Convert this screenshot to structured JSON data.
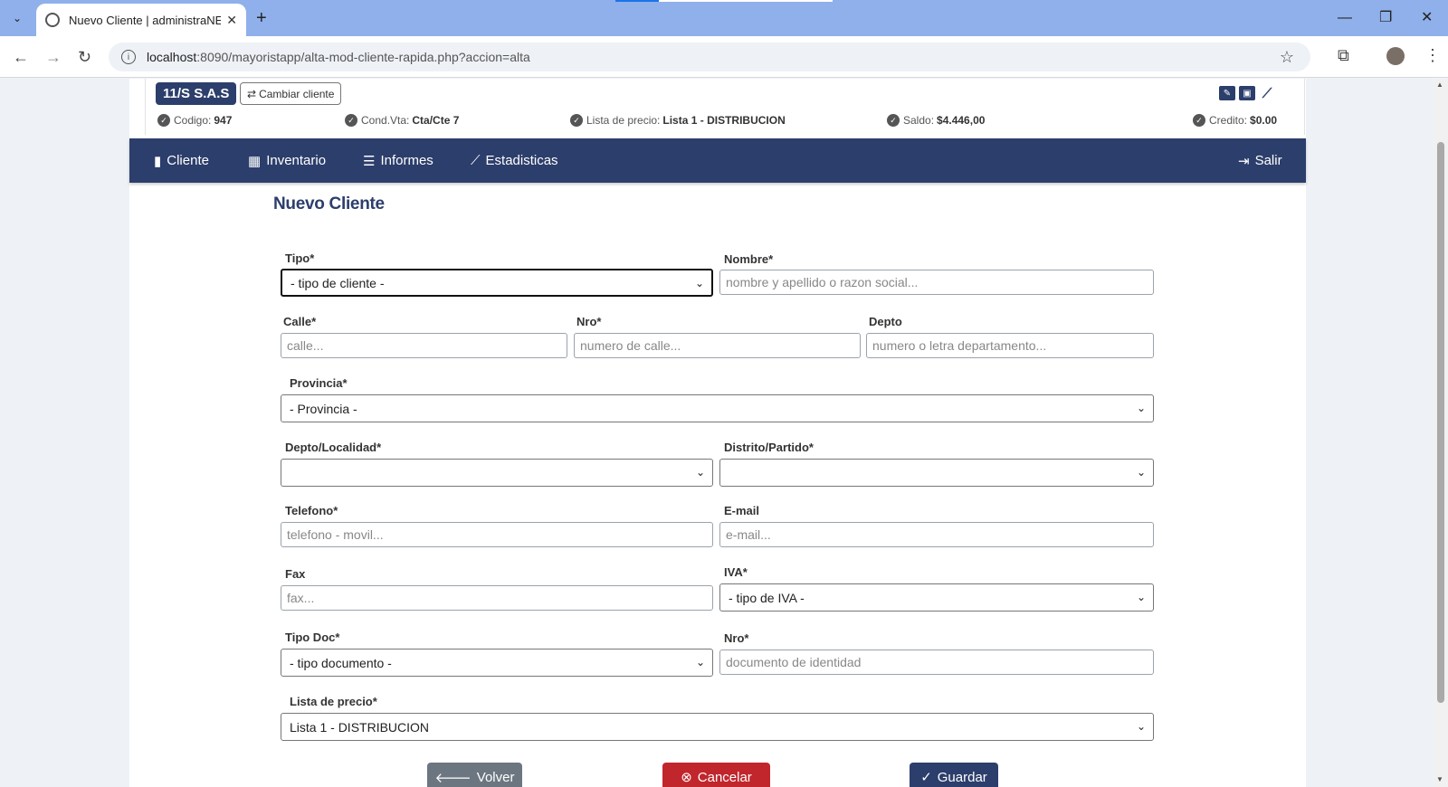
{
  "browser": {
    "tab_title": "Nuevo Cliente | administraNET",
    "url_host": "localhost",
    "url_path": ":8090/mayoristapp/alta-mod-cliente-rapida.php?accion=alta"
  },
  "client": {
    "name": "11/S S.A.S",
    "change_label": "Cambiar cliente",
    "stats": [
      {
        "label": "Codigo:",
        "value": "947"
      },
      {
        "label": "Cond.Vta:",
        "value": "Cta/Cte 7"
      },
      {
        "label": "Lista de precio:",
        "value": "Lista 1 - DISTRIBUCION"
      },
      {
        "label": "Saldo:",
        "value": "$4.446,00"
      },
      {
        "label": "Credito:",
        "value": "$0.00"
      }
    ]
  },
  "nav": {
    "cliente": "Cliente",
    "inventario": "Inventario",
    "informes": "Informes",
    "estadisticas": "Estadisticas",
    "salir": "Salir"
  },
  "form": {
    "title": "Nuevo Cliente",
    "tipo": {
      "label": "Tipo*",
      "value": "- tipo de cliente -"
    },
    "nombre": {
      "label": "Nombre*",
      "placeholder": "nombre y apellido o razon social..."
    },
    "calle": {
      "label": "Calle*",
      "placeholder": "calle..."
    },
    "nro": {
      "label": "Nro*",
      "placeholder": "numero de calle..."
    },
    "depto": {
      "label": "Depto",
      "placeholder": "numero o letra departamento..."
    },
    "provincia": {
      "label": "Provincia*",
      "value": "- Provincia -"
    },
    "localidad": {
      "label": "Depto/Localidad*",
      "value": ""
    },
    "distrito": {
      "label": "Distrito/Partido*",
      "value": ""
    },
    "telefono": {
      "label": "Telefono*",
      "placeholder": "telefono - movil..."
    },
    "email": {
      "label": "E-mail",
      "placeholder": "e-mail..."
    },
    "fax": {
      "label": "Fax",
      "placeholder": "fax..."
    },
    "iva": {
      "label": "IVA*",
      "value": "- tipo de IVA -"
    },
    "tipo_doc": {
      "label": "Tipo Doc*",
      "value": "- tipo documento -"
    },
    "nro_doc": {
      "label": "Nro*",
      "placeholder": "documento de identidad"
    },
    "lista_precio": {
      "label": "Lista de precio*",
      "value": "Lista 1 - DISTRIBUCION"
    }
  },
  "buttons": {
    "volver": "Volver",
    "cancelar": "Cancelar",
    "guardar": "Guardar"
  },
  "colors": {
    "primary": "#2c3e6b",
    "cancel": "#c0262c",
    "secondary": "#6c7680"
  }
}
